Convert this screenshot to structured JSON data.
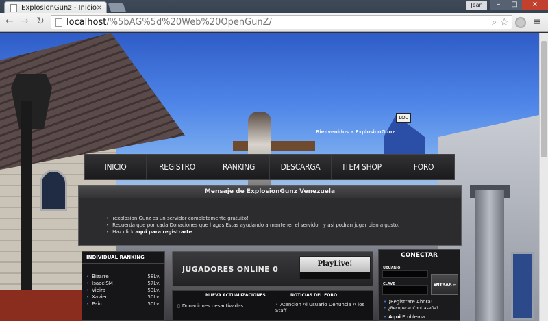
{
  "browser": {
    "tab_title": "ExplosionGunz - Inicio",
    "tab_close": "×",
    "user_badge": "Jean",
    "win_min": "–",
    "win_max": "□",
    "win_close": "×",
    "url_host": "localhost",
    "url_path": "/%5bAG%5d%20Web%20OpenGunZ/"
  },
  "scene": {
    "sign_text": "LOL",
    "welcome": "Bienvenidos a ExplosionGunz"
  },
  "nav": {
    "items": [
      "INICIO",
      "REGISTRO",
      "RANKING",
      "DESCARGA",
      "ITEM SHOP",
      "FORO"
    ]
  },
  "message": {
    "title": "Mensaje de ExplosionGunz Venezuela",
    "lines": [
      "¡explosion Gunz es un servidor completamente gratuito!",
      "Recuerda que por cada Donaciones que hagas Estas ayudando a mantener el servidor, y asi podran jugar bien a gusto."
    ],
    "link_prefix": "Haz click ",
    "link_text": "aqui para registrarte"
  },
  "ranking": {
    "title": "INDIVIDUAL RANKING",
    "rows": [
      {
        "name": "Bizarre",
        "level": "58Lv."
      },
      {
        "name": "IsaacISM",
        "level": "57Lv."
      },
      {
        "name": "Vieira",
        "level": "53Lv."
      },
      {
        "name": "Xavier",
        "level": "50Lv."
      },
      {
        "name": "Pain",
        "level": "50Lv."
      }
    ]
  },
  "online": {
    "text": "JUGADORES ONLINE 0",
    "button": "PlayLive!"
  },
  "updates": {
    "updates_header": "NUEVA ACTUALIZACIONES",
    "forum_header": "NOTICIAS DEL FORO",
    "update_item": "Donaciones desactivadas",
    "forum_item": "Atencion Al Usuario Denuncia A los Staff"
  },
  "login": {
    "title": "CONECTAR",
    "user_label": "USUARIO",
    "pass_label": "CLAVE",
    "enter": "ENTRAR »",
    "register": "¡Registrate Ahora!",
    "recover": "¿Recuperar Contraseña?",
    "emblem_strong": "Aqui",
    "emblem_rest": " Emblema"
  }
}
